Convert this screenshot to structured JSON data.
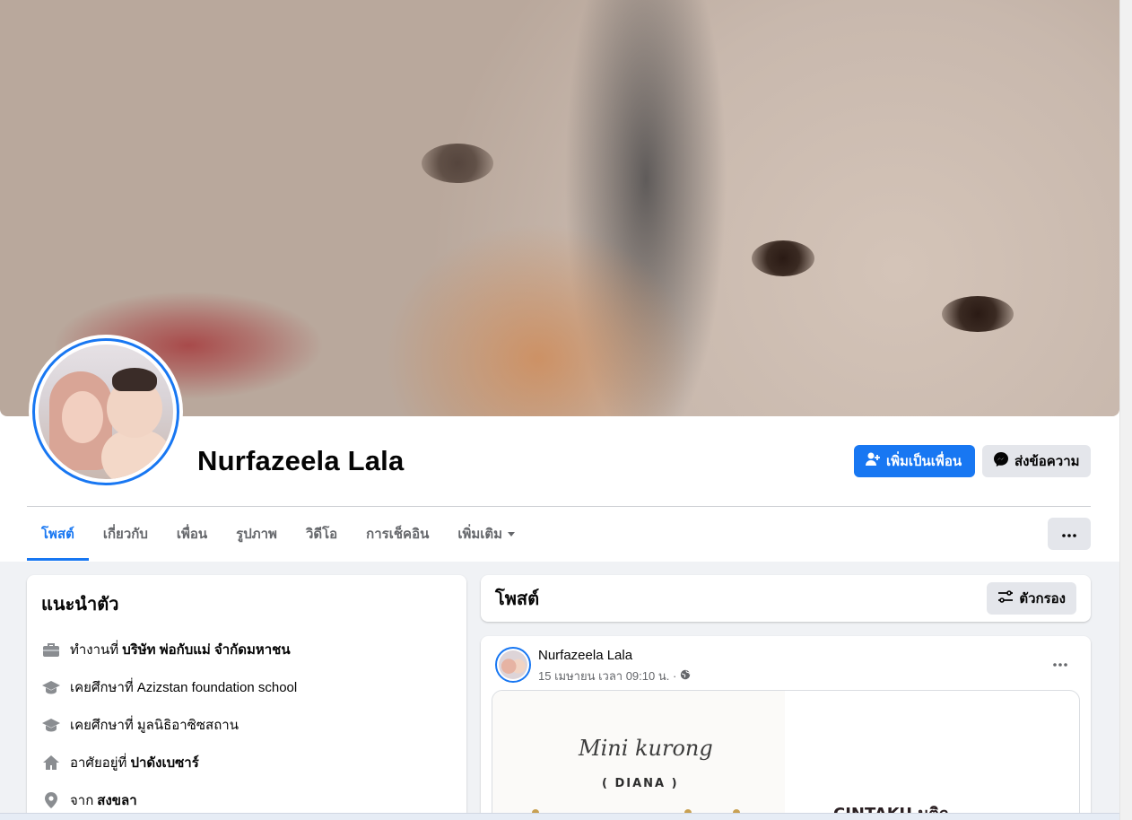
{
  "profile": {
    "name": "Nurfazeela Lala",
    "add_friend_label": "เพิ่มเป็นเพื่อน",
    "message_label": "ส่งข้อความ"
  },
  "tabs": [
    {
      "label": "โพสต์",
      "active": true
    },
    {
      "label": "เกี่ยวกับ",
      "active": false
    },
    {
      "label": "เพื่อน",
      "active": false
    },
    {
      "label": "รูปภาพ",
      "active": false
    },
    {
      "label": "วิดีโอ",
      "active": false
    },
    {
      "label": "การเช็คอิน",
      "active": false
    },
    {
      "label": "เพิ่มเติม",
      "active": false
    }
  ],
  "intro": {
    "title": "แนะนำตัว",
    "items": [
      {
        "icon": "briefcase-icon",
        "prefix": "ทำงานที่",
        "value": "บริษัท พ่อกับแม่ จำกัดมหาชน",
        "bold": true
      },
      {
        "icon": "graduation-cap-icon",
        "prefix": "เคยศึกษาที่",
        "value": "Azizstan foundation school",
        "bold": false
      },
      {
        "icon": "graduation-cap-icon",
        "prefix": "เคยศึกษาที่",
        "value": "มูลนิธิอาซิซสถาน",
        "bold": false
      },
      {
        "icon": "home-icon",
        "prefix": "อาศัยอยู่ที่",
        "value": "ปาดังเบซาร์",
        "bold": true
      },
      {
        "icon": "location-pin-icon",
        "prefix": "จาก",
        "value": "สงขลา",
        "bold": true
      }
    ]
  },
  "posts": {
    "title": "โพสต์",
    "filter_label": "ตัวกรอง",
    "first_post": {
      "author": "Nurfazeela Lala",
      "meta": "15 เมษายน เวลา 09:10 น. ·",
      "image_text": {
        "title": "Mini kurong",
        "subtitle": "( DIANA )",
        "right_text": "CINTAKU มติก"
      }
    }
  },
  "colors": {
    "accent": "#1877f2",
    "secondary_button": "#e4e6eb",
    "page_bg": "#f0f2f5"
  }
}
